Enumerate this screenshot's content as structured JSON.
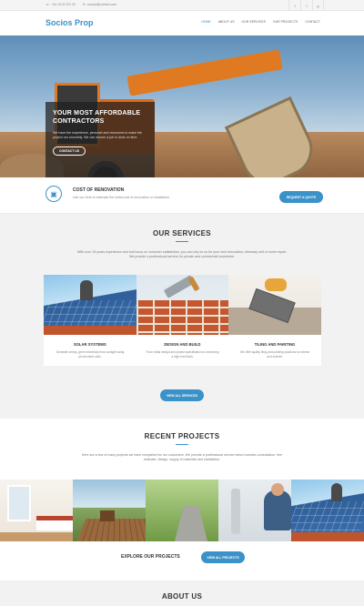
{
  "topbar": {
    "phone": "+44 15 22 222 33",
    "email": "contact@contact.com",
    "social": [
      "f",
      "t",
      "g"
    ]
  },
  "header": {
    "logo": "Socios Prop",
    "nav": [
      "HOME",
      "ABOUT US",
      "OUR SERVICES",
      "OUR PROJECTS",
      "CONTACT"
    ]
  },
  "hero": {
    "title": "YOUR MOST AFFORDABLE CONTRACTORS",
    "text": "We have the experience, personel and resources to make the project run smoothly. We can ensure a job is done on time.",
    "button": "CONTACT US"
  },
  "cost": {
    "title": "COST OF RENOVATION",
    "description": "Use our form to estimate the initial cost of renovation or installation",
    "button": "REQUEST A QUOTE"
  },
  "services": {
    "title": "OUR SERVICES",
    "intro": "With over 15 years experience and real focus on customer satisfaction, you can rely on us for your next renovation, driveway sett or home repair. We provide a professional service for private and commercial customers.",
    "items": [
      {
        "name": "SOLAR SYSTEMS",
        "desc": "Generate cheap, green electricity from sunlight using photovoltaic cells."
      },
      {
        "name": "DESIGN AND BUILD",
        "desc": "From initial design and project specification to archieving a high end finish."
      },
      {
        "name": "TILING AND PAINTING",
        "desc": "We offer quality tiling and painting solutions for interior and exterior."
      }
    ],
    "button": "VIEW ALL SERVICES"
  },
  "projects": {
    "title": "RECENT PROJECTS",
    "intro": "Here are a few of many projects we have completed for our customers. We provide a professional service which includes consultation, free estimate, design, supply of materials and installation.",
    "explore": "EXPLORE OUR PROJECTS",
    "button": "VIEW ALL PROJECTS"
  },
  "about": {
    "title": "ABOUT US"
  },
  "colors": {
    "accent": "#3a92c9",
    "section_gray": "#f2f2f2"
  }
}
